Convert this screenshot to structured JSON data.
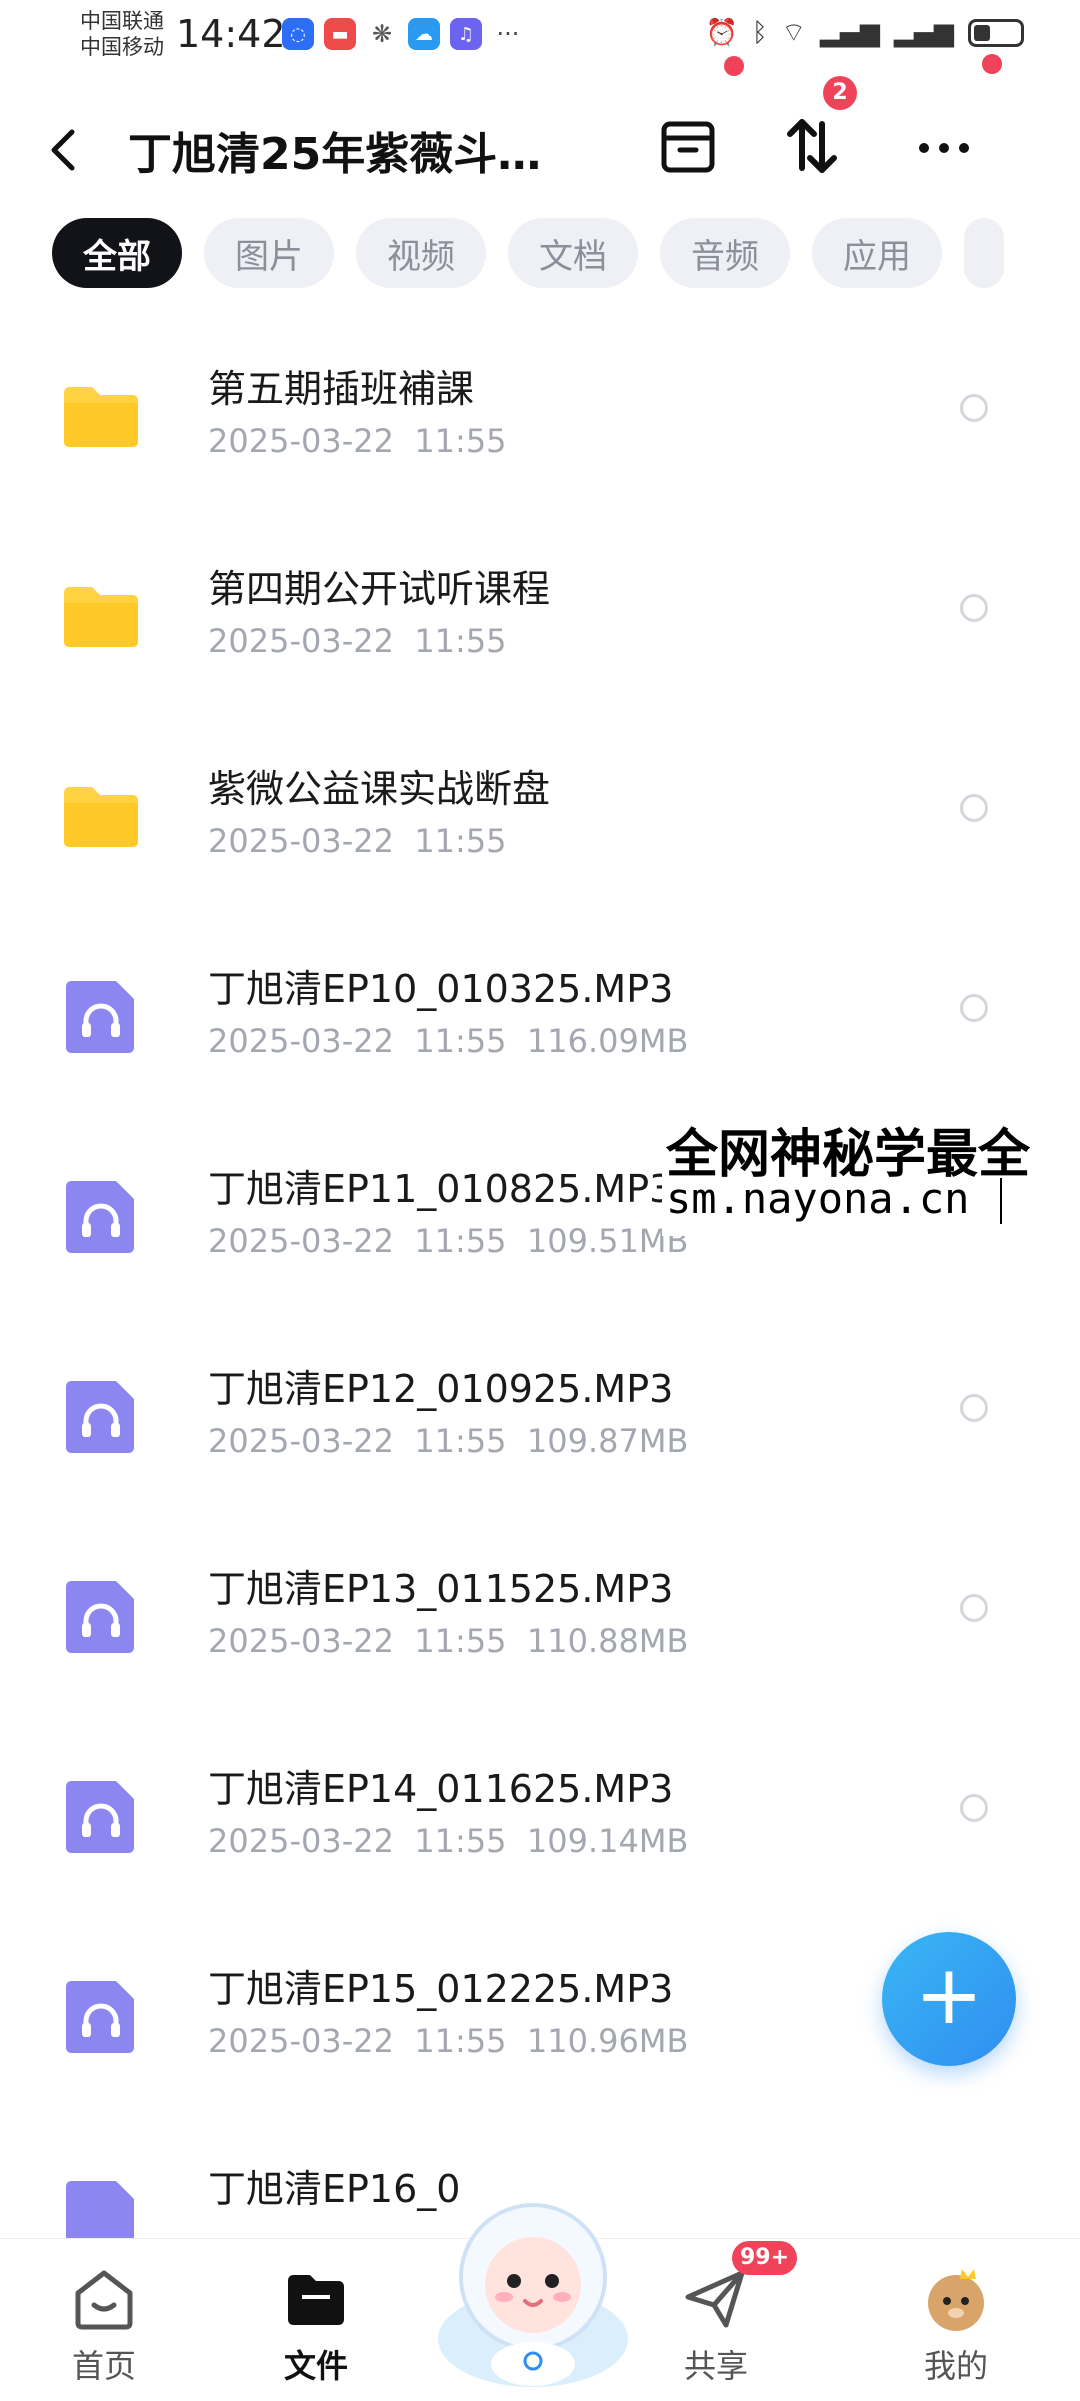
{
  "status_bar": {
    "carrier1": "中国联通",
    "carrier2": "中国移动",
    "time": "14:42",
    "more": "···"
  },
  "header": {
    "title": "丁旭清25年紫薇斗…",
    "transfer_badge": "2"
  },
  "tabs": [
    {
      "label": "全部",
      "active": true
    },
    {
      "label": "图片",
      "active": false
    },
    {
      "label": "视频",
      "active": false
    },
    {
      "label": "文档",
      "active": false
    },
    {
      "label": "音频",
      "active": false
    },
    {
      "label": "应用",
      "active": false
    }
  ],
  "files": [
    {
      "name": "第五期插班補課",
      "meta": "2025-03-22  11:55",
      "type": "folder"
    },
    {
      "name": "第四期公开试听课程",
      "meta": "2025-03-22  11:55",
      "type": "folder"
    },
    {
      "name": "紫微公益课实战断盘",
      "meta": "2025-03-22  11:55",
      "type": "folder"
    },
    {
      "name": "丁旭清EP10_010325.MP3",
      "meta": "2025-03-22  11:55  116.09MB",
      "type": "audio"
    },
    {
      "name": "丁旭清EP11_010825.MP3",
      "meta": "2025-03-22  11:55  109.51MB",
      "type": "audio"
    },
    {
      "name": "丁旭清EP12_010925.MP3",
      "meta": "2025-03-22  11:55  109.87MB",
      "type": "audio"
    },
    {
      "name": "丁旭清EP13_011525.MP3",
      "meta": "2025-03-22  11:55  110.88MB",
      "type": "audio"
    },
    {
      "name": "丁旭清EP14_011625.MP3",
      "meta": "2025-03-22  11:55  109.14MB",
      "type": "audio"
    },
    {
      "name": "丁旭清EP15_012225.MP3",
      "meta": "2025-03-22  11:55  110.96MB",
      "type": "audio"
    },
    {
      "name": "丁旭清EP16_0",
      "meta": "",
      "type": "audio"
    }
  ],
  "watermark": {
    "line1": "全网神秘学最全",
    "line2": "sm.nayona.cn"
  },
  "fab": {
    "label": "+"
  },
  "bottom_nav": {
    "home": "首页",
    "files": "文件",
    "share": "共享",
    "share_badge": "99+",
    "mine": "我的"
  },
  "colors": {
    "accent": "#2f8ef0",
    "tab_active_bg": "#111318",
    "badge_red": "#f0435a",
    "folder_yellow": "#ffd23f",
    "audio_purple": "#8b86f0"
  }
}
